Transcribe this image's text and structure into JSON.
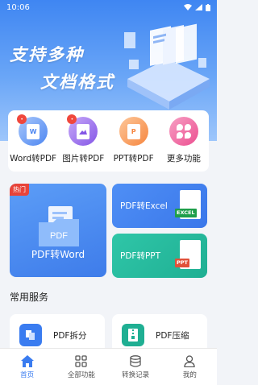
{
  "status": {
    "time": "10:06"
  },
  "banner": {
    "slogan_line1": "支持多种",
    "slogan_line2": "文档格式"
  },
  "tools": [
    {
      "label": "Word转PDF",
      "badge": "W",
      "icon": "word-doc-icon"
    },
    {
      "label": "图片转PDF",
      "badge": "",
      "icon": "image-doc-icon"
    },
    {
      "label": "PPT转PDF",
      "badge": "P",
      "icon": "ppt-doc-icon"
    },
    {
      "label": "更多功能",
      "icon": "clover-icon"
    }
  ],
  "feature": {
    "hot_tag": "热门",
    "pdf_word": {
      "label": "PDF转Word",
      "folder_text": "PDF"
    },
    "pdf_excel": {
      "label": "PDF转Excel",
      "file_text": "EXCEL"
    },
    "pdf_ppt": {
      "label": "PDF转PPT",
      "file_text": "PPT"
    }
  },
  "services": {
    "title": "常用服务",
    "items": [
      {
        "label": "PDF拆分",
        "icon": "split-icon"
      },
      {
        "label": "PDF压缩",
        "icon": "compress-icon"
      }
    ]
  },
  "tabs": [
    {
      "label": "首页",
      "icon": "home-icon",
      "active": true
    },
    {
      "label": "全部功能",
      "icon": "grid-icon"
    },
    {
      "label": "转换记录",
      "icon": "history-icon"
    },
    {
      "label": "我的",
      "icon": "user-icon"
    }
  ],
  "colors": {
    "primary": "#3a7cf0",
    "hot": "#e8443a",
    "ppt_green": "#1faf93",
    "excel_green": "#1e9e4a",
    "ppt_red": "#e0513a"
  }
}
